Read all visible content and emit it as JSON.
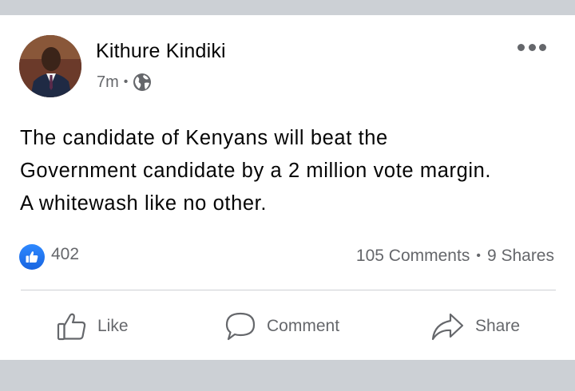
{
  "post": {
    "author": "Kithure Kindiki",
    "time": "7m",
    "separator": "•",
    "privacy_icon": "globe-icon",
    "more_icon": "more-options-icon",
    "text_lines": [
      "The candidate of Kenyans will beat the",
      "Government candidate by a 2 million vote margin.",
      "A whitewash like no other."
    ]
  },
  "reactions": {
    "icon": "like-reaction-icon",
    "count": "402",
    "comments": "105 Comments",
    "separator": "•",
    "shares": "9 Shares"
  },
  "actions": {
    "like_label": "Like",
    "comment_label": "Comment",
    "share_label": "Share"
  },
  "colors": {
    "background": "#ccd0d5",
    "card": "#ffffff",
    "text": "#050505",
    "secondary_text": "#65676b",
    "like_blue": "#1877f2"
  }
}
